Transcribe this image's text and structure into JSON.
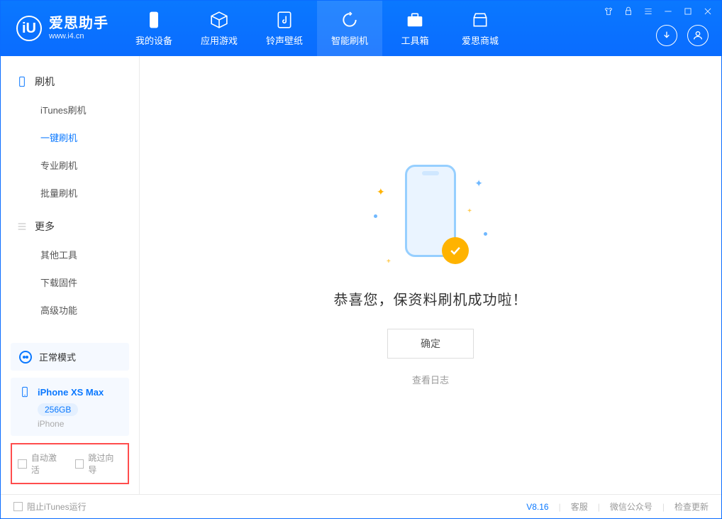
{
  "app": {
    "name": "爱思助手",
    "url": "www.i4.cn"
  },
  "nav": {
    "items": [
      {
        "label": "我的设备",
        "icon": "device"
      },
      {
        "label": "应用游戏",
        "icon": "cube"
      },
      {
        "label": "铃声壁纸",
        "icon": "music"
      },
      {
        "label": "智能刷机",
        "icon": "refresh",
        "active": true
      },
      {
        "label": "工具箱",
        "icon": "toolbox"
      },
      {
        "label": "爱思商城",
        "icon": "store"
      }
    ]
  },
  "sidebar": {
    "sections": [
      {
        "title": "刷机",
        "icon": "phone",
        "items": [
          "iTunes刷机",
          "一键刷机",
          "专业刷机",
          "批量刷机"
        ],
        "active_index": 1
      },
      {
        "title": "更多",
        "icon": "menu",
        "items": [
          "其他工具",
          "下载固件",
          "高级功能"
        ]
      }
    ],
    "status": "正常模式",
    "device": {
      "name": "iPhone XS Max",
      "capacity": "256GB",
      "type": "iPhone"
    },
    "options": {
      "auto_activate": "自动激活",
      "skip_guide": "跳过向导"
    }
  },
  "main": {
    "success_text": "恭喜您，保资料刷机成功啦！",
    "ok_button": "确定",
    "log_link": "查看日志"
  },
  "footer": {
    "block_itunes": "阻止iTunes运行",
    "version": "V8.16",
    "links": [
      "客服",
      "微信公众号",
      "检查更新"
    ]
  }
}
